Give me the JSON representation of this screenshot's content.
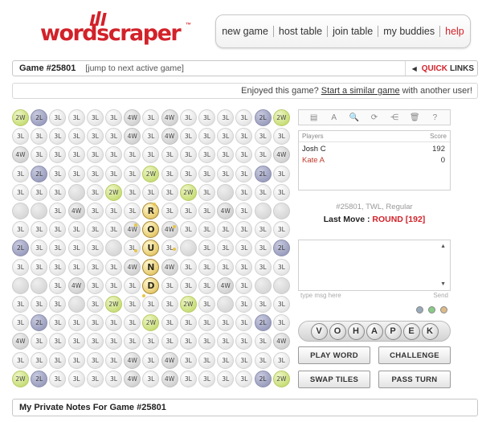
{
  "header": {
    "logo_text": "wordscraper",
    "logo_tm": "™",
    "nav": [
      {
        "label": "new game",
        "name": "nav-new-game"
      },
      {
        "label": "host table",
        "name": "nav-host-table"
      },
      {
        "label": "join table",
        "name": "nav-join-table"
      },
      {
        "label": "my buddies",
        "name": "nav-my-buddies"
      },
      {
        "label": "help",
        "name": "nav-help"
      }
    ]
  },
  "gamebar": {
    "title": "Game #25801",
    "jump": "[jump to next active game]",
    "quick": "QUICK",
    "links": "LINKS"
  },
  "enjoy": {
    "prefix": "Enjoyed this game?",
    "link": "Start a similar game",
    "suffix": "with another user!"
  },
  "board": {
    "rows": [
      [
        "2W",
        "2L",
        "3L",
        "3L",
        "3L",
        "3L",
        "4W",
        "3L",
        "4W",
        "3L",
        "3L",
        "3L",
        "3L",
        "2L",
        "2W"
      ],
      [
        "3L",
        "3L",
        "3L",
        "3L",
        "3L",
        "3L",
        "4W",
        "3L",
        "4W",
        "3L",
        "3L",
        "3L",
        "3L",
        "3L",
        "3L"
      ],
      [
        "4W",
        "3L",
        "3L",
        "3L",
        "3L",
        "3L",
        "3L",
        "3L",
        "3L",
        "3L",
        "3L",
        "3L",
        "3L",
        "3L",
        "4W"
      ],
      [
        "3L",
        "2L",
        "3L",
        "3L",
        "3L",
        "3L",
        "3L",
        "2W",
        "3L",
        "3L",
        "3L",
        "3L",
        "3L",
        "2L",
        "3L"
      ],
      [
        "3L",
        "3L",
        "3L",
        "",
        "3L",
        "2W",
        "3L",
        "3L",
        "3L",
        "2W",
        "3L",
        "",
        "3L",
        "3L",
        "3L"
      ],
      [
        "",
        "",
        "3L",
        "4W",
        "3L",
        "3L",
        "3L",
        "R",
        "3L",
        "3L",
        "3L",
        "4W",
        "3L",
        "",
        ""
      ],
      [
        "3L",
        "3L",
        "3L",
        "3L",
        "3L",
        "3L",
        "4W",
        "O",
        "4W",
        "3L",
        "3L",
        "3L",
        "3L",
        "3L",
        "3L"
      ],
      [
        "2L",
        "3L",
        "3L",
        "3L",
        "3L",
        "",
        "3L",
        "U",
        "3L",
        "",
        "3L",
        "3L",
        "3L",
        "3L",
        "2L"
      ],
      [
        "3L",
        "3L",
        "3L",
        "3L",
        "3L",
        "3L",
        "4W",
        "N",
        "4W",
        "3L",
        "3L",
        "3L",
        "3L",
        "3L",
        "3L"
      ],
      [
        "",
        "",
        "3L",
        "4W",
        "3L",
        "3L",
        "3L",
        "D",
        "3L",
        "3L",
        "3L",
        "4W",
        "3L",
        "",
        ""
      ],
      [
        "3L",
        "3L",
        "3L",
        "",
        "3L",
        "2W",
        "3L",
        "3L",
        "3L",
        "2W",
        "3L",
        "",
        "3L",
        "3L",
        "3L"
      ],
      [
        "3L",
        "2L",
        "3L",
        "3L",
        "3L",
        "3L",
        "3L",
        "2W",
        "3L",
        "3L",
        "3L",
        "3L",
        "3L",
        "2L",
        "3L"
      ],
      [
        "4W",
        "3L",
        "3L",
        "3L",
        "3L",
        "3L",
        "3L",
        "3L",
        "3L",
        "3L",
        "3L",
        "3L",
        "3L",
        "3L",
        "4W"
      ],
      [
        "3L",
        "3L",
        "3L",
        "3L",
        "3L",
        "3L",
        "4W",
        "3L",
        "4W",
        "3L",
        "3L",
        "3L",
        "3L",
        "3L",
        "3L"
      ],
      [
        "2W",
        "2L",
        "3L",
        "3L",
        "3L",
        "3L",
        "4W",
        "3L",
        "4W",
        "3L",
        "3L",
        "3L",
        "3L",
        "2L",
        "2W"
      ]
    ]
  },
  "toolbar": {
    "icons": [
      "notepad-icon",
      "font-icon",
      "magnify-icon",
      "refresh-icon",
      "share-icon",
      "trash-icon",
      "help-icon"
    ],
    "glyphs": [
      "▤",
      "A",
      "🔍",
      "⟳",
      "⋲",
      "🗑",
      "?"
    ]
  },
  "players": {
    "col_players": "Players",
    "col_score": "Score",
    "list": [
      {
        "name": "Josh C",
        "score": "192",
        "color": "#222222"
      },
      {
        "name": "Kate A",
        "score": "0",
        "color": "#c0392b"
      }
    ]
  },
  "info": {
    "sub": "#25801, TWL, Regular",
    "last_move_label": "Last Move :",
    "last_move_word": "ROUND",
    "last_move_pts": "[192]"
  },
  "chat": {
    "placeholder": "type msg here",
    "send": "Send"
  },
  "rack": {
    "tiles": [
      "V",
      "O",
      "H",
      "A",
      "P",
      "E",
      "K"
    ]
  },
  "buttons": {
    "play_word": "PLAY WORD",
    "challenge": "CHALLENGE",
    "swap_tiles": "SWAP TILES",
    "pass_turn": "PASS TURN"
  },
  "notes": {
    "title": "My Private Notes For Game #25801"
  },
  "colors": {
    "brand": "#d2222a",
    "tile": "#e9cf76"
  }
}
